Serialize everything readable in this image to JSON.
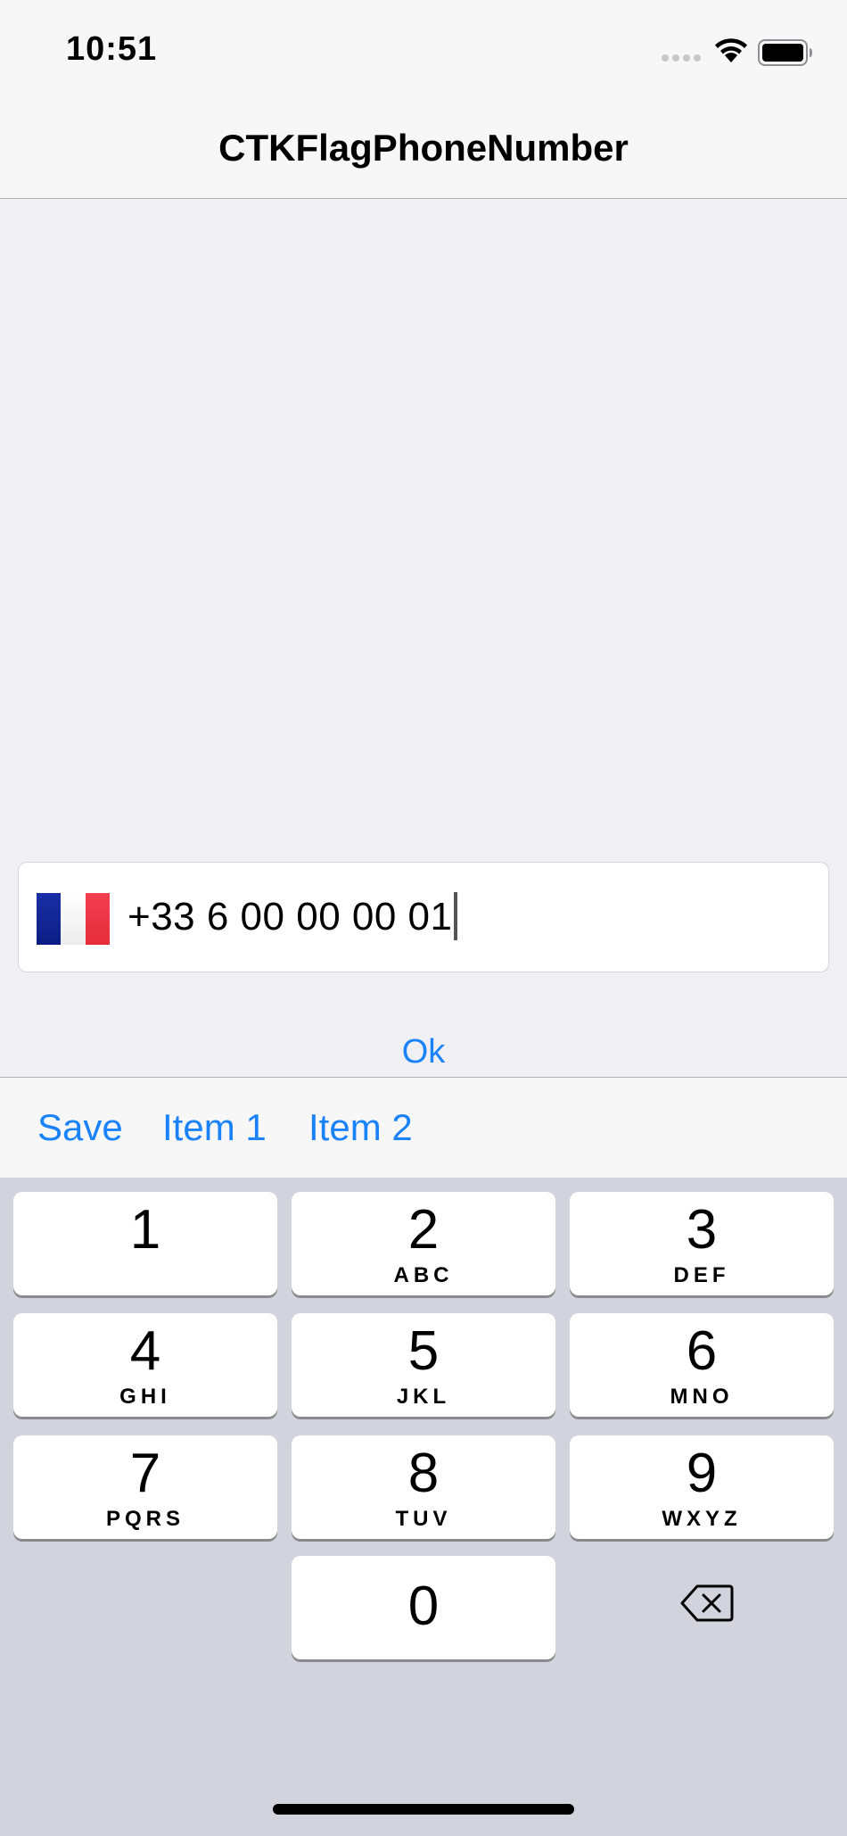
{
  "status_bar": {
    "time": "10:51"
  },
  "nav": {
    "title": "CTKFlagPhoneNumber"
  },
  "phone_field": {
    "country_flag": "france-flag-icon",
    "value": "+33 6 00 00 00 01"
  },
  "ok_button": {
    "label": "Ok"
  },
  "toolbar": {
    "items": [
      {
        "label": "Save"
      },
      {
        "label": "Item 1"
      },
      {
        "label": "Item 2"
      }
    ]
  },
  "keyboard": {
    "keys": [
      {
        "digit": "1",
        "letters": ""
      },
      {
        "digit": "2",
        "letters": "ABC"
      },
      {
        "digit": "3",
        "letters": "DEF"
      },
      {
        "digit": "4",
        "letters": "GHI"
      },
      {
        "digit": "5",
        "letters": "JKL"
      },
      {
        "digit": "6",
        "letters": "MNO"
      },
      {
        "digit": "7",
        "letters": "PQRS"
      },
      {
        "digit": "8",
        "letters": "TUV"
      },
      {
        "digit": "9",
        "letters": "WXYZ"
      },
      {
        "digit": "0",
        "letters": ""
      }
    ],
    "delete_icon": "backspace-icon"
  },
  "colors": {
    "accent": "#1a82fb",
    "background": "#efeff4",
    "keyboard_background": "#d1d4dc",
    "bar_background": "#f7f7f7"
  }
}
